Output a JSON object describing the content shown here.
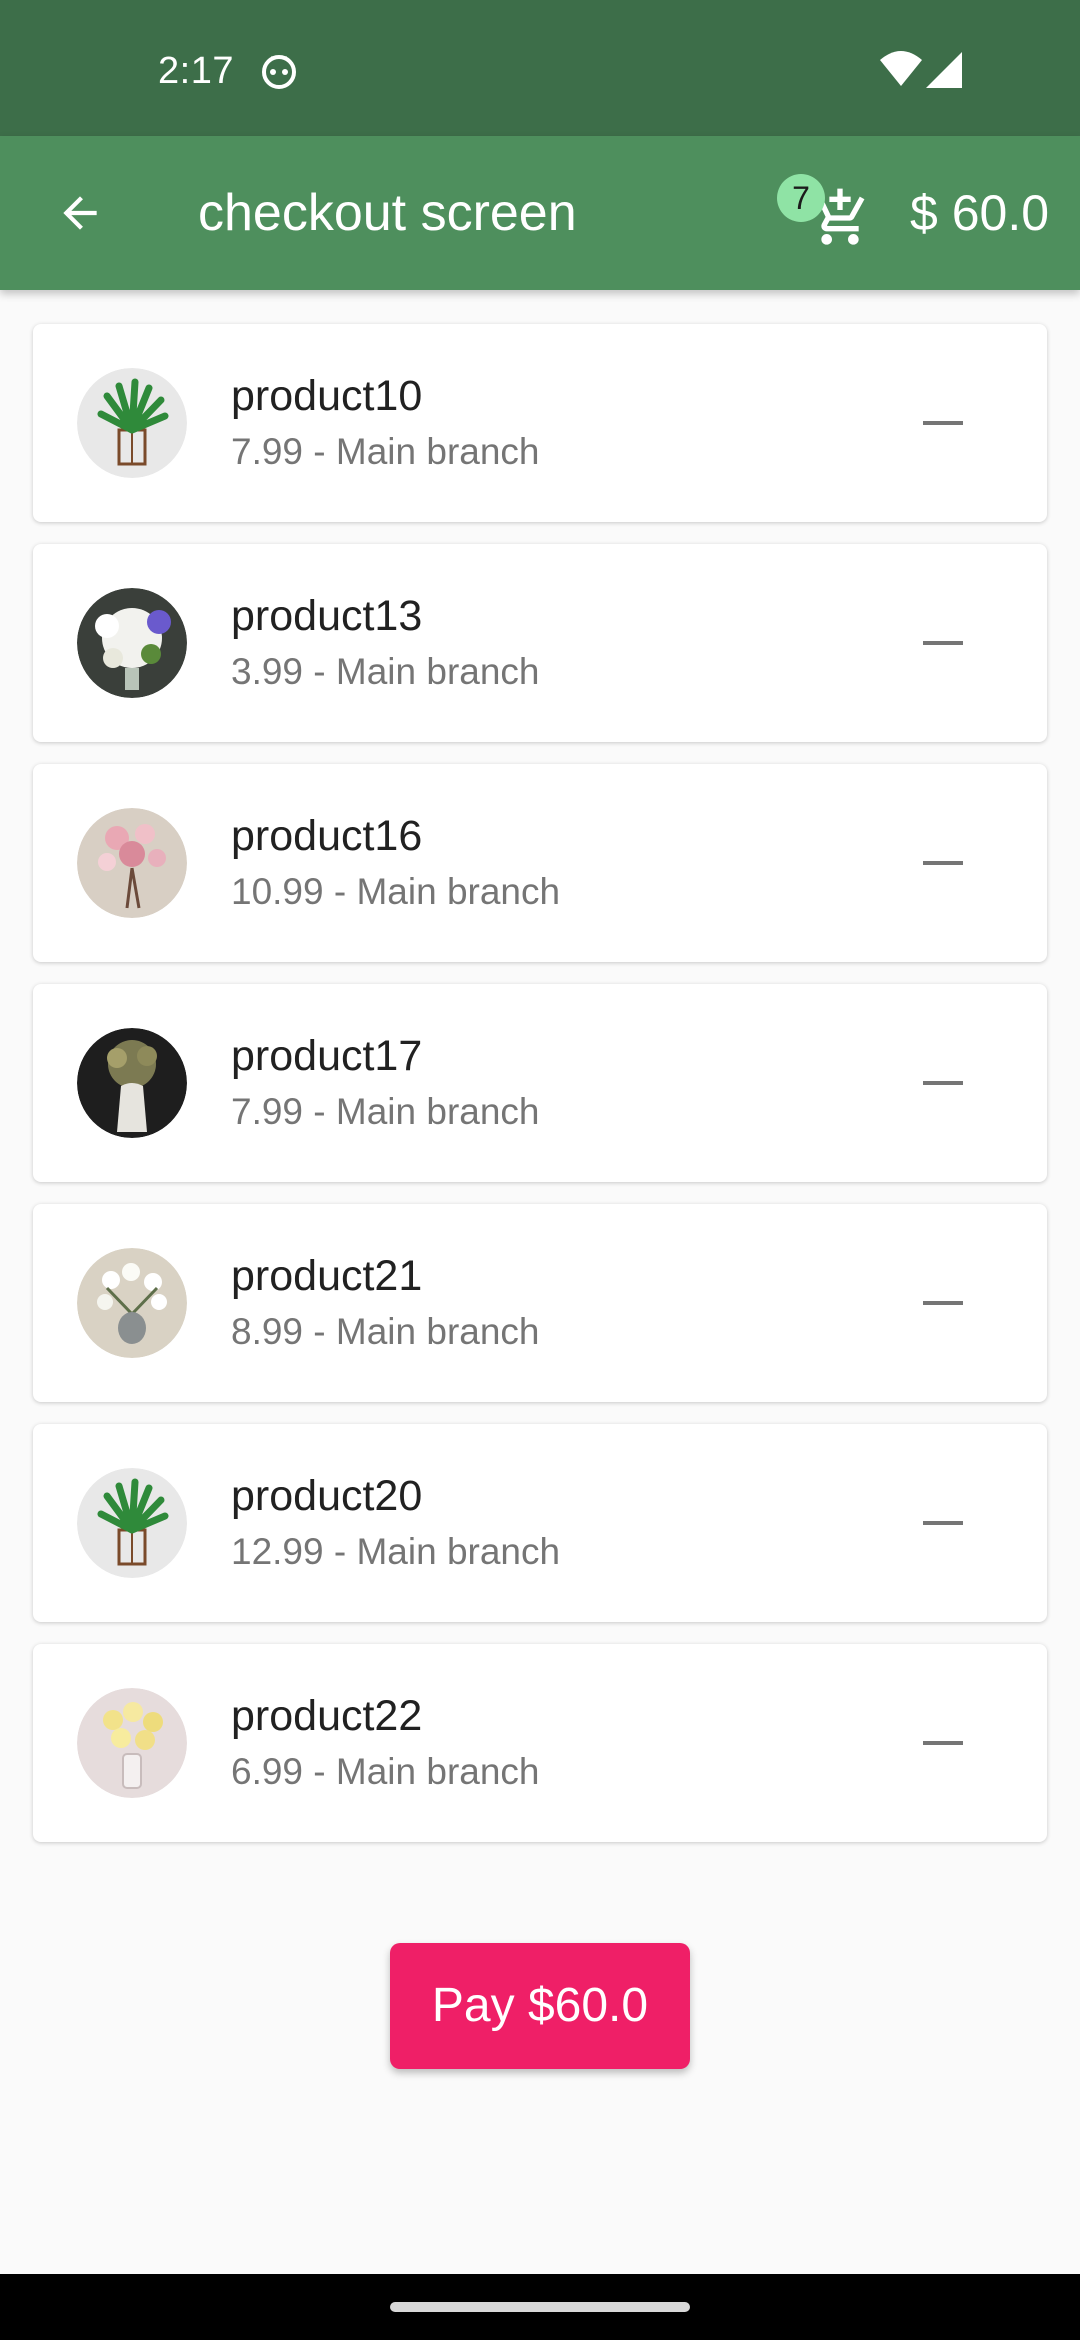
{
  "status_bar": {
    "time": "2:17"
  },
  "app_bar": {
    "title": "checkout screen",
    "cart_count": "7",
    "cart_total": "$ 60.0"
  },
  "products": [
    {
      "name": "product10",
      "detail": "7.99 - Main branch",
      "image": "leafy-plant-stand"
    },
    {
      "name": "product13",
      "detail": "3.99 - Main branch",
      "image": "white-purple-bouquet"
    },
    {
      "name": "product16",
      "detail": "10.99 - Main branch",
      "image": "pink-blossom-vase"
    },
    {
      "name": "product17",
      "detail": "7.99 - Main branch",
      "image": "dried-flowers-dark"
    },
    {
      "name": "product21",
      "detail": "8.99 - Main branch",
      "image": "white-orchid-vase"
    },
    {
      "name": "product20",
      "detail": "12.99 - Main branch",
      "image": "leafy-plant-stand"
    },
    {
      "name": "product22",
      "detail": "6.99 - Main branch",
      "image": "yellow-roses-vase"
    }
  ],
  "pay_button": {
    "label": "Pay $60.0"
  },
  "colors": {
    "status_bar": "#3d6e49",
    "app_bar": "#4e8f5d",
    "badge": "#8fe3a5",
    "pay_button": "#ef1f67",
    "background": "#fafafa"
  }
}
